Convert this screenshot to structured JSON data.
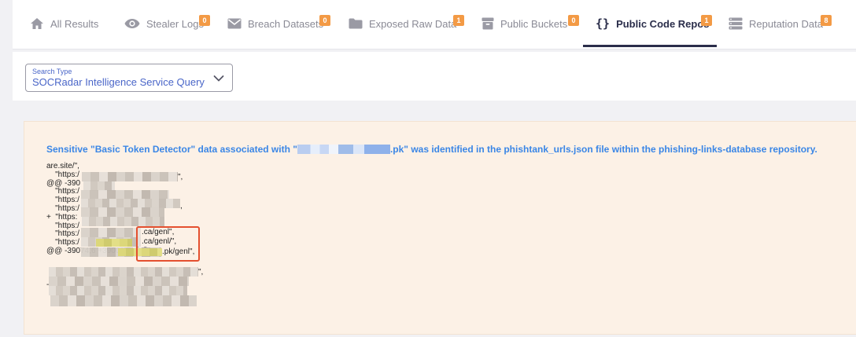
{
  "tabs": [
    {
      "label": "All Results",
      "icon": "home-icon",
      "badge": ""
    },
    {
      "label": "Stealer Logs",
      "icon": "eye-icon",
      "badge": "0"
    },
    {
      "label": "Breach Datasets",
      "icon": "envelope-icon",
      "badge": "0"
    },
    {
      "label": "Exposed Raw Data",
      "icon": "folder-icon",
      "badge": "1"
    },
    {
      "label": "Public Buckets",
      "icon": "archive-icon",
      "badge": "0"
    },
    {
      "label": "Public Code Repos",
      "icon": "code-braces-icon",
      "badge": "1"
    },
    {
      "label": "Reputation Data",
      "icon": "server-icon",
      "badge": "8"
    }
  ],
  "active_tab": "Public Code Repos",
  "search": {
    "label": "Search Type",
    "value": "SOCRadar Intelligence Service Query"
  },
  "result": {
    "headline_prefix": "Sensitive \"Basic Token Detector\" data associated with \"",
    "headline_suffix": ".pk\" was identified in the phishtank_urls.json file within the phishing-links-database repository.",
    "code_lines": [
      "are.site/\",",
      "    \"https:/",
      "@@ -390",
      "    \"https:/",
      "    \"https:/",
      "    \"https:/",
      "+  \"https:",
      "    \"https:/",
      "    \"https:/",
      "    \"https:/",
      "@@ -39074,6 +39002,7 @@",
      "",
      "",
      "",
      "-"
    ],
    "fragments": {
      "l1_end": "\",",
      "l4_end": ",",
      "ca1": ".ca/genl\",",
      "ca2": ".ca/genl/\",",
      "pk": ".pk/genl\",",
      "l11_end": "\","
    }
  }
}
